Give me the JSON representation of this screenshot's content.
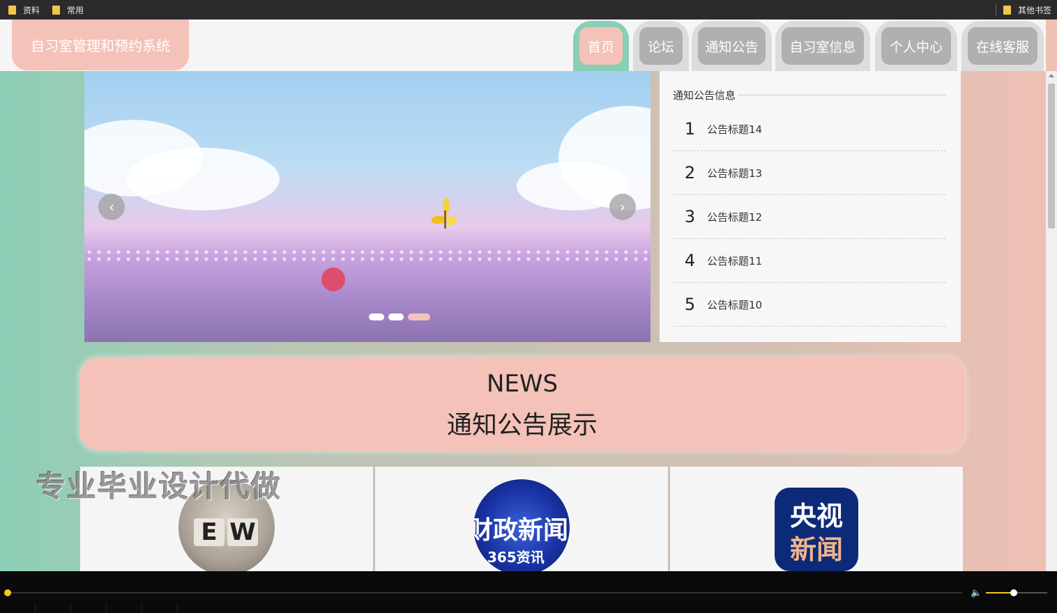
{
  "bookmarks": {
    "items": [
      {
        "label": "资料"
      },
      {
        "label": "常用"
      }
    ],
    "other": "其他书签"
  },
  "site": {
    "title": "自习室管理和预约系统",
    "nav": [
      {
        "label": "首页",
        "active": true
      },
      {
        "label": "论坛"
      },
      {
        "label": "通知公告"
      },
      {
        "label": "自习室信息"
      },
      {
        "label": "个人中心"
      },
      {
        "label": "在线客服"
      }
    ],
    "colors": {
      "accent": "#f4c2b8",
      "active_border": "#8acfb5",
      "tab_inactive": "#b0b0b0"
    }
  },
  "carousel": {
    "prev_icon": "chevron-left-icon",
    "next_icon": "chevron-right-icon",
    "slide_count": 3,
    "active_index": 2
  },
  "notices": {
    "heading": "通知公告信息",
    "items": [
      {
        "num": "1",
        "title": "公告标题14"
      },
      {
        "num": "2",
        "title": "公告标题13"
      },
      {
        "num": "3",
        "title": "公告标题12"
      },
      {
        "num": "4",
        "title": "公告标题11"
      },
      {
        "num": "5",
        "title": "公告标题10"
      }
    ]
  },
  "news": {
    "en": "NEWS",
    "cn": "通知公告展示",
    "cards": [
      {
        "image_text": [
          "E",
          "W"
        ]
      },
      {
        "image_text": [
          "财政新闻",
          "365资讯"
        ]
      },
      {
        "image_text": [
          "央视",
          "新闻"
        ]
      }
    ]
  },
  "watermark": "专业毕业设计代做",
  "player": {
    "progress": 0.0,
    "volume": 0.45
  }
}
